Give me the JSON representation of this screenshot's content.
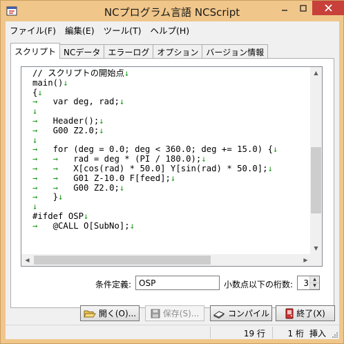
{
  "window": {
    "title": "NCプログラム言語 NCScript"
  },
  "menu": [
    "ファイル(F)",
    "編集(E)",
    "ツール(T)",
    "ヘルプ(H)"
  ],
  "tabs": [
    "スクリプト",
    "NCデータ",
    "エラーログ",
    "オプション",
    "バージョン情報"
  ],
  "editor": {
    "lines": [
      {
        "indent": 0,
        "text": "// スクリプトの開始点"
      },
      {
        "indent": 0,
        "text": "main()"
      },
      {
        "indent": 0,
        "text": "{"
      },
      {
        "indent": 1,
        "text": "var deg, rad;"
      },
      {
        "indent": 0,
        "text": ""
      },
      {
        "indent": 1,
        "text": "Header();"
      },
      {
        "indent": 1,
        "text": "G00 Z2.0;"
      },
      {
        "indent": 0,
        "text": ""
      },
      {
        "indent": 1,
        "text": "for (deg = 0.0; deg < 360.0; deg += 15.0) {"
      },
      {
        "indent": 2,
        "text": "rad = deg * (PI / 180.0);"
      },
      {
        "indent": 2,
        "text": "X[cos(rad) * 50.0] Y[sin(rad) * 50.0];"
      },
      {
        "indent": 2,
        "text": "G01 Z-10.0 F[feed];"
      },
      {
        "indent": 2,
        "text": "G00 Z2.0;"
      },
      {
        "indent": 1,
        "text": "}"
      },
      {
        "indent": 0,
        "text": ""
      },
      {
        "indent": 0,
        "text": "#ifdef OSP"
      },
      {
        "indent": 1,
        "text": "@CALL O[SubNo];"
      }
    ],
    "arrow_glyph": "→",
    "newline_glyph": "↓"
  },
  "options": {
    "condition_label": "条件定義:",
    "condition_value": "OSP",
    "digits_label": "小数点以下の桁数:",
    "digits_value": "3"
  },
  "buttons": {
    "open": "開く(O)...",
    "save": "保存(S)...",
    "compile": "コンパイル",
    "exit": "終了(X)"
  },
  "status": {
    "line": "19 行",
    "col": "1 桁",
    "mode": "挿入"
  }
}
